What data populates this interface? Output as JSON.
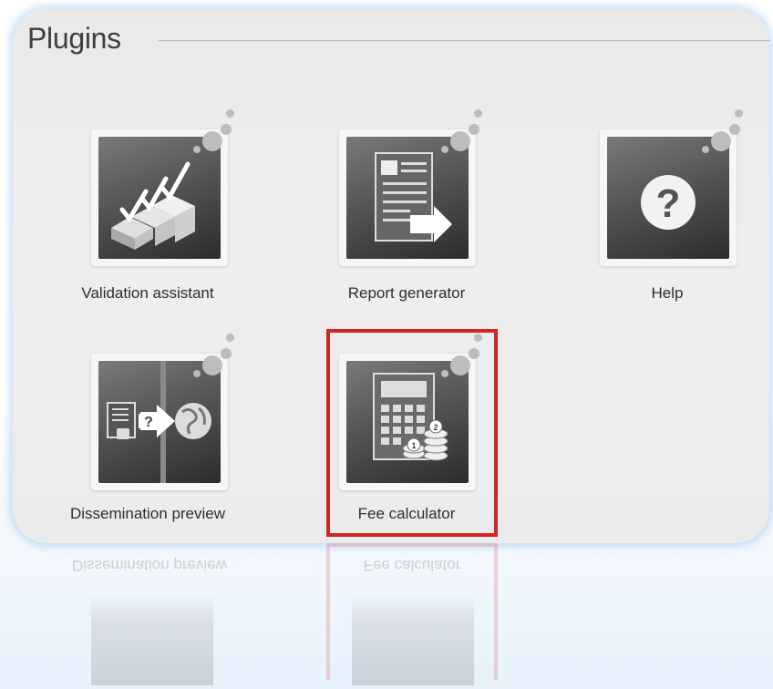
{
  "panel": {
    "title": "Plugins"
  },
  "plugins": [
    {
      "label": "Validation assistant",
      "icon": "validation-checkmarks-icon"
    },
    {
      "label": "Report generator",
      "icon": "report-document-icon"
    },
    {
      "label": "Help",
      "icon": "help-question-icon"
    },
    {
      "label": "Dissemination preview",
      "icon": "dissemination-globe-icon"
    },
    {
      "label": "Fee calculator",
      "icon": "calculator-coins-icon"
    }
  ],
  "selected_plugin": "Fee calculator",
  "colors": {
    "selection_border": "#d32424",
    "glow": "#8cbeeb"
  }
}
